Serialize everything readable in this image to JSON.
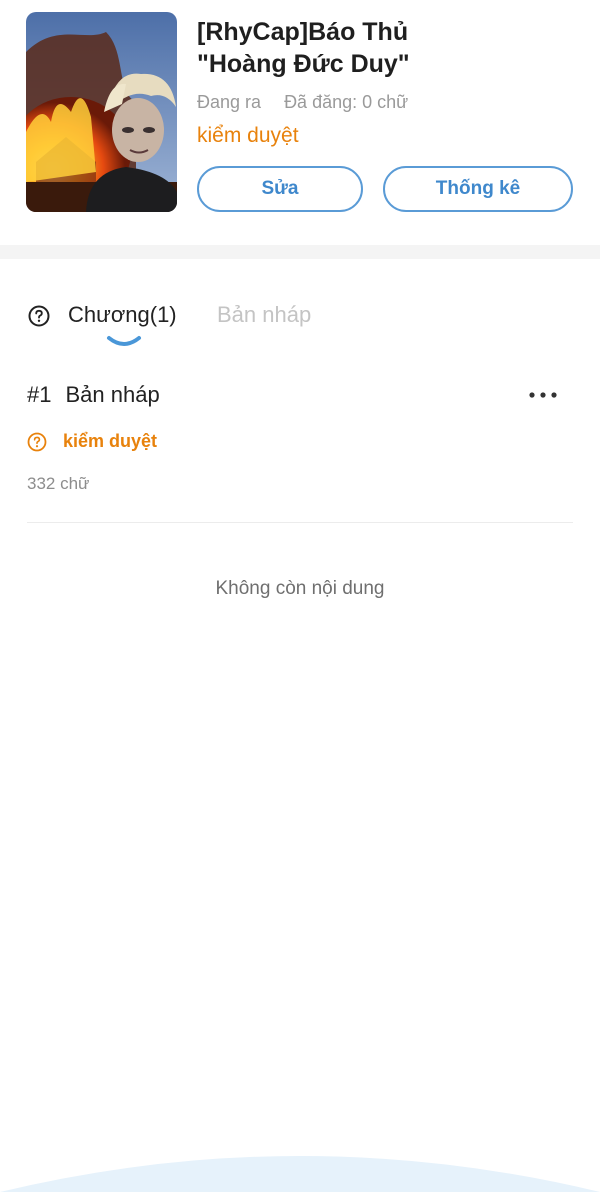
{
  "story": {
    "title_line1": "[RhyCap]Báo Thủ",
    "title_line2": "\"Hoàng Đức Duy\"",
    "status": "Đang ra",
    "published": "Đã đăng: 0 chữ",
    "review_status": "kiểm duyệt",
    "cover_icon": "cover-image"
  },
  "actions": {
    "edit_label": "Sửa",
    "stats_label": "Thống kê"
  },
  "tabs": {
    "chapters_label": "Chương(1)",
    "drafts_label": "Bản nháp"
  },
  "chapters": [
    {
      "number": "#1",
      "title": "Bản nháp",
      "status": "kiểm duyệt",
      "words": "332 chữ"
    }
  ],
  "footer": {
    "empty_text": "Không còn nội dung"
  },
  "colors": {
    "accent": "#3f88cc",
    "warning": "#e8820c",
    "muted": "#9a9a9a"
  }
}
